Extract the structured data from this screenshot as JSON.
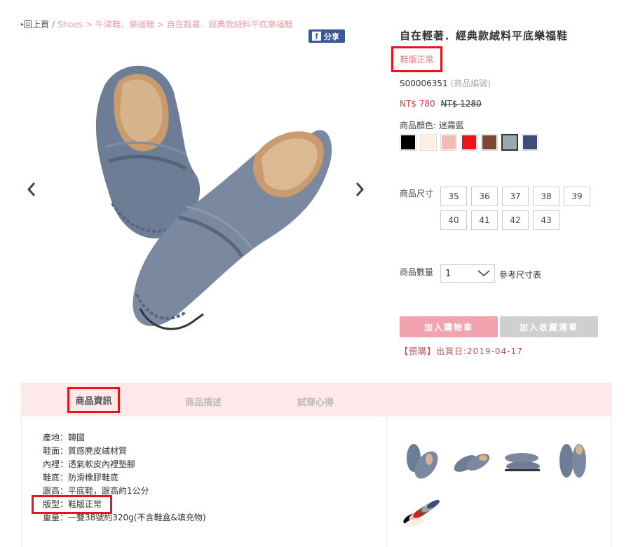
{
  "breadcrumb": {
    "back": "回上頁",
    "sep": "/",
    "path": "Shoes > 牛津鞋、樂福鞋 > 自在輕著．經典款絨料平底樂福鞋"
  },
  "share": {
    "label": "分享"
  },
  "product": {
    "title": "自在輕著．經典款絨料平底樂福鞋",
    "fit": "鞋版正常",
    "sku": "S00006351",
    "sku_note": "(商品編號)",
    "price_now": "NT$ 780",
    "price_old": "NT$ 1280",
    "color_label": "商品顏色: 迷霧藍",
    "colors": [
      {
        "name": "black",
        "hex": "#000000"
      },
      {
        "name": "cream",
        "hex": "#fbeee4"
      },
      {
        "name": "pink",
        "hex": "#f2bdb2"
      },
      {
        "name": "red",
        "hex": "#e8131b"
      },
      {
        "name": "brown",
        "hex": "#7a4a33"
      },
      {
        "name": "misty-blue",
        "hex": "#98a8af",
        "selected": true
      },
      {
        "name": "navy",
        "hex": "#3f4b7a"
      }
    ],
    "size_label": "商品尺寸",
    "sizes": [
      "35",
      "36",
      "37",
      "38",
      "39",
      "40",
      "41",
      "42",
      "43"
    ],
    "qty_label": "商品數量",
    "qty_value": "1",
    "size_chart": "參考尺寸表",
    "add_to_cart": "加入購物車",
    "add_to_wishlist": "加入收藏清單",
    "ship_note": "【預購】出貨日:2019-04-17"
  },
  "tabs": [
    "商品資訊",
    "商品描述",
    "試穿心得"
  ],
  "specs": [
    "產地：韓國",
    "鞋面：質感麂皮絨材質",
    "內裡：透氣軟皮內裡墊腳",
    "鞋底：防滑橡膠鞋底",
    "跟高：平底鞋，跟高約1公分",
    "版型：鞋版正常",
    "重量：一雙38號約320g(不含鞋盒&填充物)"
  ],
  "icons": {
    "prev": "chevron-left-icon",
    "next": "chevron-right-icon",
    "share": "facebook-icon",
    "qty": "chevron-down-icon"
  },
  "accent": {
    "pink": "#f3a3ad",
    "tab_bg": "#fde8ea",
    "highlight": "#e8141b"
  }
}
